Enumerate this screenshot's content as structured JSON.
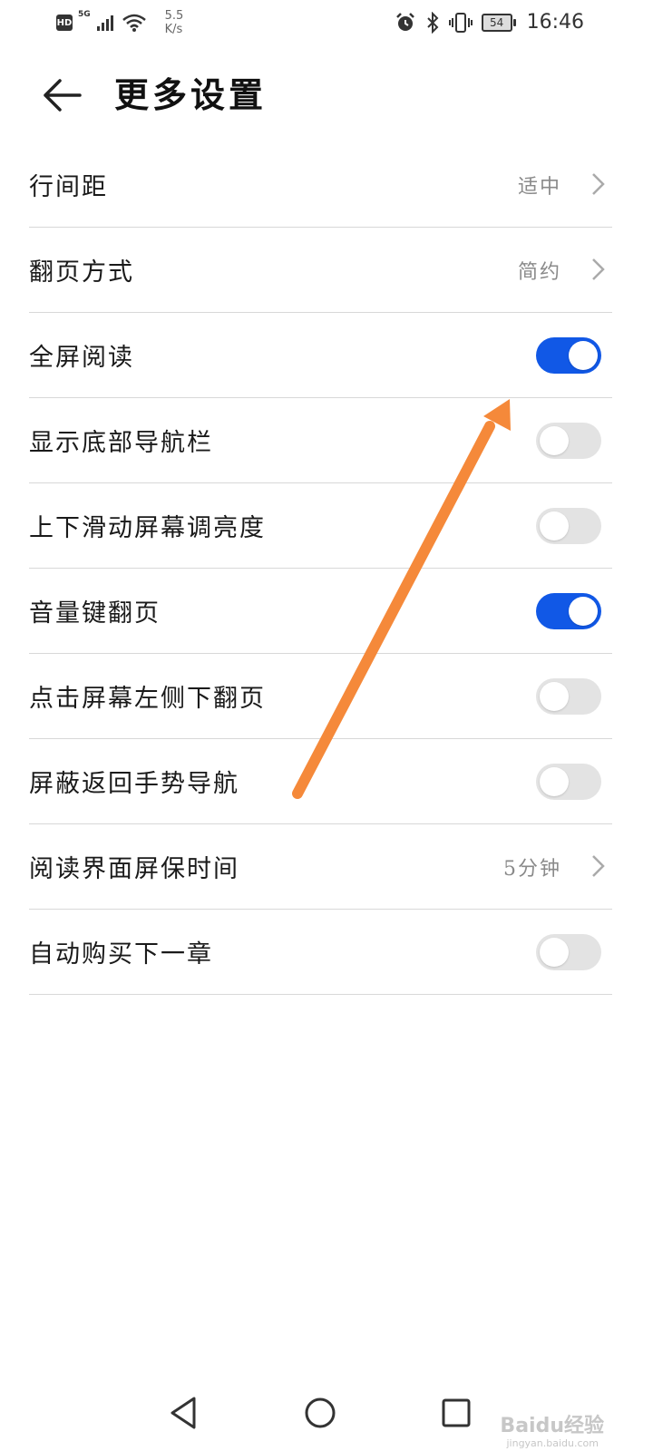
{
  "status_bar": {
    "hd_badge": "HD",
    "network_type": "5G",
    "speed_value": "5.5",
    "speed_unit": "K/s",
    "battery": "54",
    "time": "16:46"
  },
  "header": {
    "title": "更多设置"
  },
  "settings": [
    {
      "label": "行间距",
      "type": "value",
      "value": "适中"
    },
    {
      "label": "翻页方式",
      "type": "value",
      "value": "简约"
    },
    {
      "label": "全屏阅读",
      "type": "toggle",
      "on": true
    },
    {
      "label": "显示底部导航栏",
      "type": "toggle",
      "on": false
    },
    {
      "label": "上下滑动屏幕调亮度",
      "type": "toggle",
      "on": false
    },
    {
      "label": "音量键翻页",
      "type": "toggle",
      "on": true
    },
    {
      "label": "点击屏幕左侧下翻页",
      "type": "toggle",
      "on": false
    },
    {
      "label": "屏蔽返回手势导航",
      "type": "toggle",
      "on": false
    },
    {
      "label": "阅读界面屏保时间",
      "type": "value",
      "value": "5分钟"
    },
    {
      "label": "自动购买下一章",
      "type": "toggle",
      "on": false
    }
  ],
  "watermark": {
    "text": "Baidu经验",
    "sub": "jingyan.baidu.com"
  },
  "colors": {
    "accent": "#1158e6",
    "toggle_off": "#e3e3e3",
    "annotation_arrow": "#f5893a"
  }
}
